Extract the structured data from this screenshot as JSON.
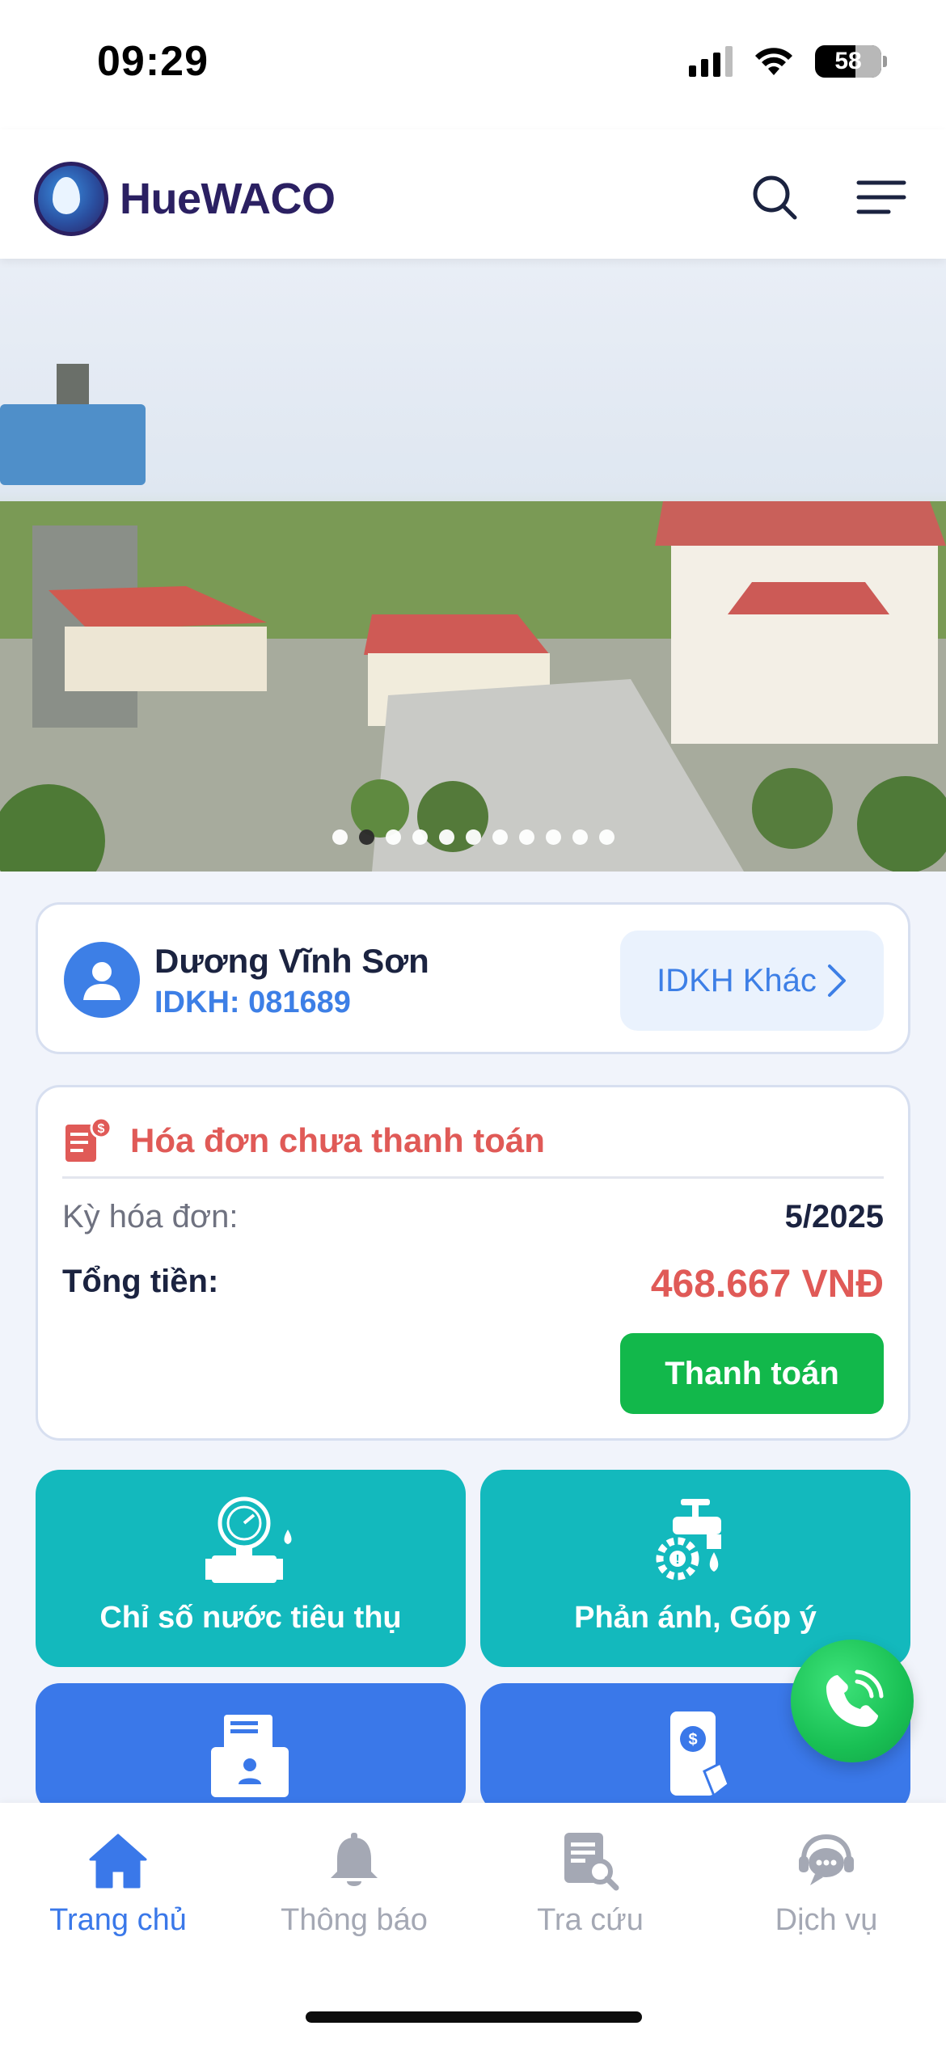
{
  "status_bar": {
    "time": "09:29",
    "battery": "58"
  },
  "header": {
    "brand": "HueWACO",
    "search_icon": "search-icon",
    "menu_icon": "menu-icon"
  },
  "banner": {
    "slide_count": 11,
    "active_index": 1
  },
  "customer": {
    "name": "Dương Vĩnh Sơn",
    "id_text": "IDKH: 081689",
    "other_id_label": "IDKH Khác"
  },
  "bill": {
    "title": "Hóa đơn chưa thanh toán",
    "period_label": "Kỳ hóa đơn:",
    "period_value": "5/2025",
    "total_label": "Tổng tiền:",
    "total_value": "468.667 VNĐ",
    "pay_label": "Thanh toán",
    "accent": "#e05a57",
    "pay_color": "#12b84b"
  },
  "tiles": [
    {
      "label": "Chỉ số nước tiêu thụ",
      "icon": "water-meter-icon",
      "color": "#13b9bd"
    },
    {
      "label": "Phản ánh, Góp ý",
      "icon": "faucet-gear-icon",
      "color": "#13b9bd"
    },
    {
      "label": "",
      "icon": "customer-documents-icon",
      "color": "#3a78e9"
    },
    {
      "label": "",
      "icon": "mobile-payment-icon",
      "color": "#3a78e9"
    }
  ],
  "tabs": [
    {
      "label": "Trang chủ",
      "icon": "home-icon",
      "active": true
    },
    {
      "label": "Thông báo",
      "icon": "bell-icon",
      "active": false
    },
    {
      "label": "Tra cứu",
      "icon": "document-search-icon",
      "active": false
    },
    {
      "label": "Dịch vụ",
      "icon": "support-chat-icon",
      "active": false
    }
  ]
}
